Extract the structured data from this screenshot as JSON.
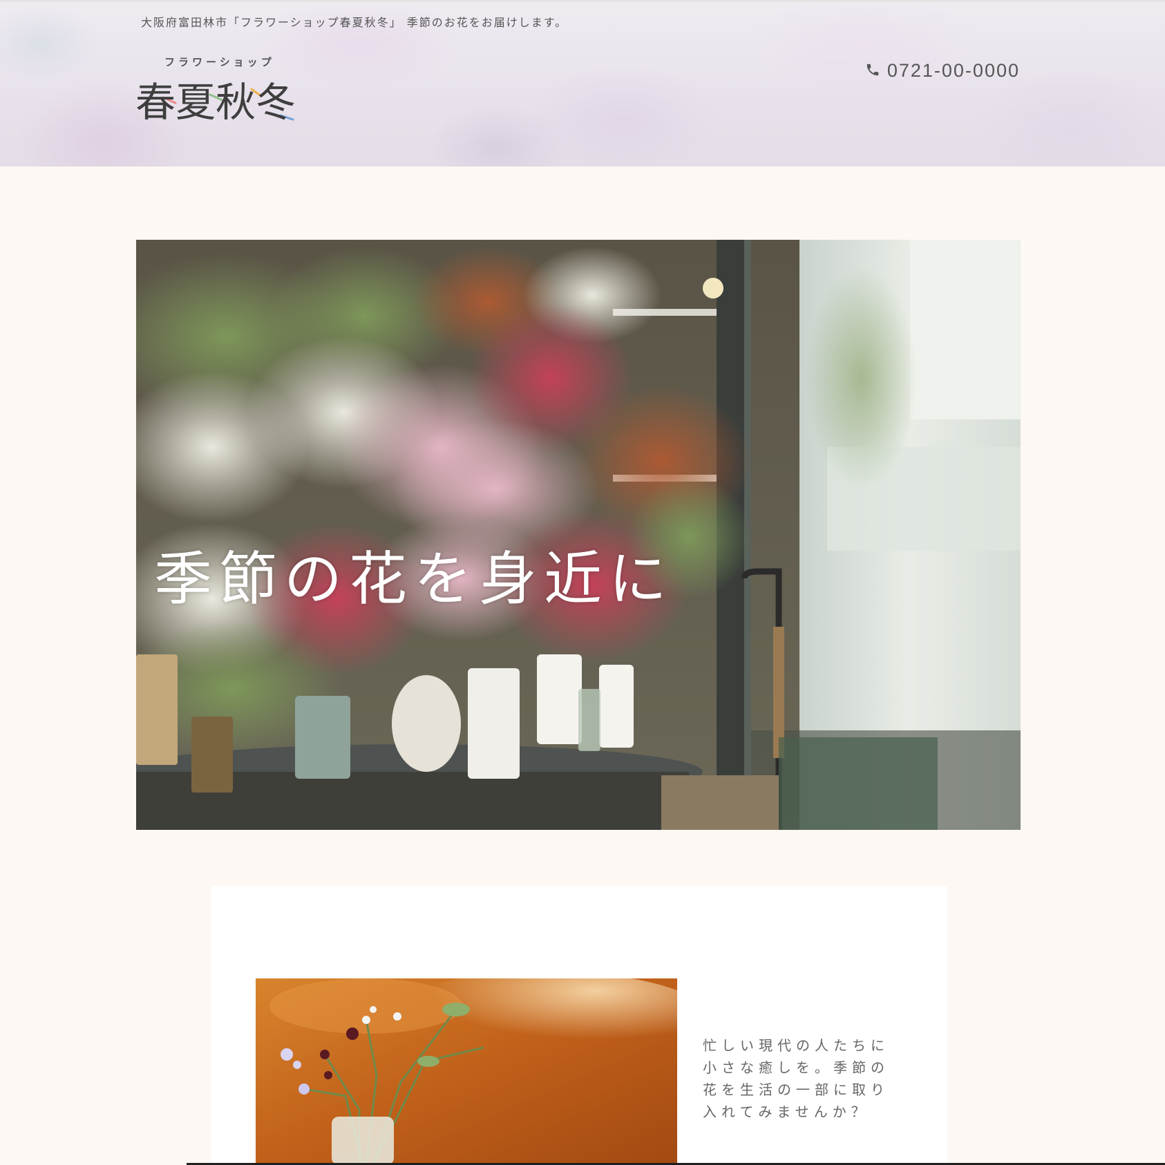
{
  "header": {
    "tagline": "大阪府富田林市「フラワーショップ春夏秋冬」 季節のお花をお届けします。",
    "logo": {
      "kana": "フラワーショップ",
      "kanji": "春夏秋冬"
    },
    "phone": {
      "icon": "phone-icon",
      "number": "0721-00-0000"
    }
  },
  "hero": {
    "title": "季節の花を身近に"
  },
  "intro": {
    "text": "忙しい現代の人たちに小さな癒しを。季節の花を生活の一部に取り入れてみませんか？"
  },
  "colors": {
    "page_background": "#fdf8f3",
    "card_background": "#ffffff",
    "text_gray": "#666666",
    "hero_title": "#ffffff"
  }
}
